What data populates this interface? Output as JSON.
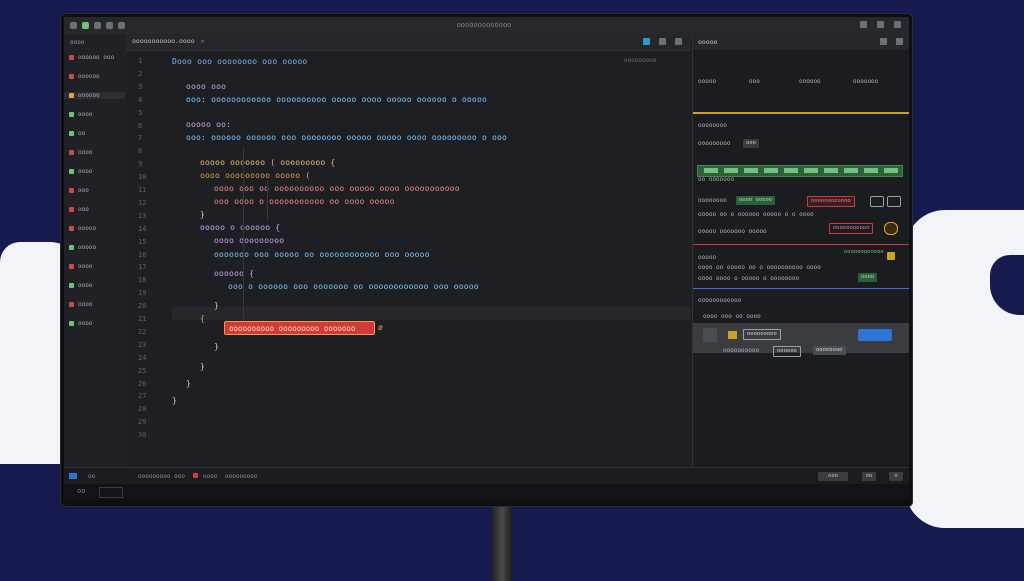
{
  "window": {
    "title": "ooooooooooooo"
  },
  "sidebar": {
    "header": "oooo",
    "items": [
      {
        "label": "oooooo ooo",
        "color": "#c94c4c"
      },
      {
        "label": "oooooo",
        "color": "#c94c4c"
      },
      {
        "label": "oooooo",
        "color": "#e8a23c"
      },
      {
        "label": "oooo",
        "color": "#6ec27a"
      },
      {
        "label": "oo",
        "color": "#6ec27a"
      },
      {
        "label": "oooo",
        "color": "#c94c4c"
      },
      {
        "label": "oooo",
        "color": "#6ec27a"
      },
      {
        "label": "ooo",
        "color": "#c94c4c"
      },
      {
        "label": "ooo",
        "color": "#c94c4c"
      },
      {
        "label": "ooooo",
        "color": "#c94c4c"
      },
      {
        "label": "ooooo",
        "color": "#6ec27a"
      },
      {
        "label": "oooo",
        "color": "#c94c4c"
      },
      {
        "label": "oooo",
        "color": "#6ec27a"
      },
      {
        "label": "oooo",
        "color": "#c94c4c"
      },
      {
        "label": "oooo",
        "color": "#6ec27a"
      }
    ]
  },
  "tab": {
    "label": "ooooooooooo.oooo",
    "close": "×"
  },
  "editor": {
    "breadcrumb": "ooooooooo",
    "line_numbers": [
      "1",
      "2",
      "3",
      "4",
      "5",
      "6",
      "7",
      "8",
      "9",
      "10",
      "11",
      "12",
      "13",
      "14",
      "15",
      "16",
      "17",
      "18",
      "19",
      "20",
      "21",
      "22",
      "23",
      "24",
      "25",
      "26",
      "27",
      "28",
      "29",
      "30"
    ],
    "lines": [
      {
        "text": "Dooo ooo oooooooo ooo ooooo",
        "color": "#7fb4f0",
        "indent": 0
      },
      {
        "text": "oooo ooo",
        "color": "#c9a6f0",
        "indent": 1
      },
      {
        "text": "ooo: oooooooooooo oooooooooo ooooo oooo ooooo oooooo o ooooo",
        "color": "#7ec6ff",
        "indent": 1
      },
      {
        "text": "ooooo oo:",
        "color": "#c9a6f0",
        "indent": 1
      },
      {
        "text": "ooo: oooooo oooooo ooo oooooooo ooooo ooooo oooo ooooooooo o ooo",
        "color": "#7ec6ff",
        "indent": 1
      },
      {
        "text": "ooooo ooooooo ( ooooooooo {",
        "color": "#e6c07b",
        "indent": 2
      },
      {
        "text": "oooo ooooooooo ooooo (",
        "color": "#e0a050",
        "indent": 2
      },
      {
        "text": "oooo ooo oo oooooooooo ooo ooooo oooo ooooooooooo",
        "color": "#f08c8c",
        "indent": 3
      },
      {
        "text": "ooo oooo o ooooooooooo oo oooo ooooo",
        "color": "#f08c8c",
        "indent": 3
      },
      {
        "text": "}",
        "color": "#c7cbd2",
        "indent": 2
      },
      {
        "text": "ooooo o oooooo {",
        "color": "#c9a6f0",
        "indent": 2
      },
      {
        "text": "oooo ooooooooo",
        "color": "#c9a6f0",
        "indent": 3
      },
      {
        "text": "ooooooo ooo ooooo oo oooooooooooo ooo ooooo",
        "color": "#7ec6ff",
        "indent": 3
      },
      {
        "text": "oooooo {",
        "color": "#c9a6f0",
        "indent": 3
      },
      {
        "text": "ooo o oooooo ooo ooooooo oo oooooooooooo ooo ooooo",
        "color": "#7ec6ff",
        "indent": 4
      },
      {
        "text": "}",
        "color": "#c7cbd2",
        "indent": 3
      },
      {
        "text": "{",
        "color": "#e8a23c",
        "indent": 2
      },
      {
        "text": "}",
        "color": "#c7cbd2",
        "indent": 3
      },
      {
        "text": "}",
        "color": "#c7cbd2",
        "indent": 2
      },
      {
        "text": "}",
        "color": "#c7cbd2",
        "indent": 1
      },
      {
        "text": "}",
        "color": "#c7cbd2",
        "indent": 0
      }
    ],
    "error_text": "oooooooooo ooooooooo ooooooo",
    "error_marker": "ø"
  },
  "panel": {
    "title": "ooooo",
    "tabs": [
      "ooooo",
      "ooo",
      "oooooo",
      "ooooooo"
    ],
    "section1_title": "oooooooo",
    "section1_field": "ooooooooo",
    "section1_chip": "ooo",
    "section2_title": "oo ooooooo",
    "section2_row1_a": "oooooooo",
    "section2_row1_b": "oooo ooooo",
    "section2_row1_c": "oooooooooooo",
    "section2_row2": "ooooo oo o oooooo ooooo o o oooo",
    "section2_row3": "ooooo ooooooo ooooo",
    "section2_warn": "ooooooooooo",
    "section3_title": "ooooo",
    "section3_row1": "oooo oo ooooo oo o oooooooooo oooo",
    "section3_row2": "oooo oooo o ooooo o oooooooo",
    "section3_chip": "oooooooooooo",
    "section3_status": "oooo",
    "section4_title": "oooooooooooo",
    "section4_sub": "oooo ooo oo oooo",
    "row1_label": "ooo ooooo",
    "row1_chip": "ooooooooo",
    "row2_label": "oooooooooo",
    "row2_chip": "oooooo",
    "row2_value": "oooooooo"
  },
  "status": {
    "left_a": "oo",
    "left_b": "ooooooooo ooo",
    "left_c": "oooo",
    "left_d": "ooooooooo",
    "btn_a": "ooo",
    "btn_b": "oo",
    "btn_c": "o",
    "bottom": "oo"
  },
  "colors": {
    "accent": "#2e73d6",
    "error": "#d23a3a",
    "warning": "#e8a23c",
    "ok": "#6ec27a"
  }
}
